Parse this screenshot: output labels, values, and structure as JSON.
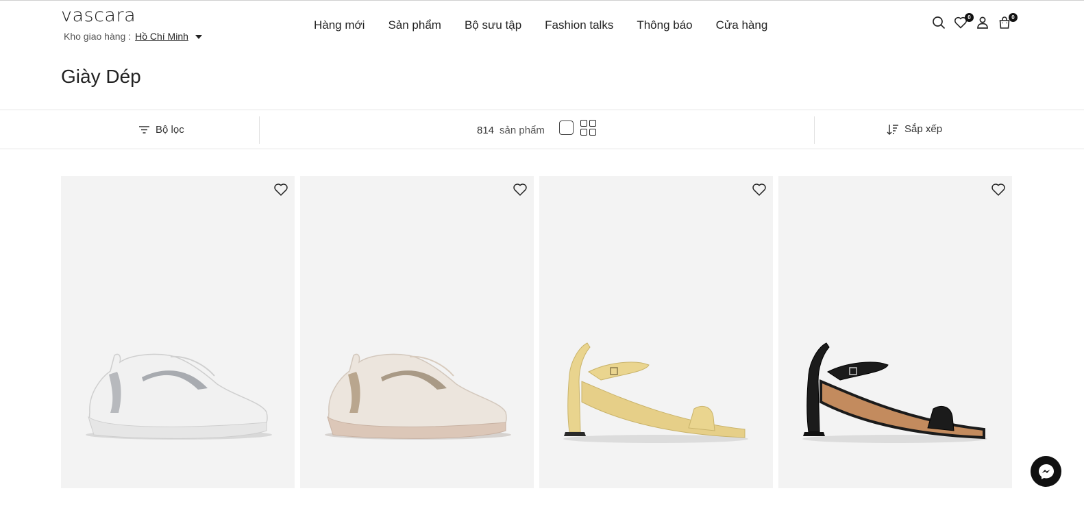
{
  "brand": {
    "logo": "vascara"
  },
  "warehouse": {
    "label": "Kho giao hàng :",
    "city": "Hồ Chí Minh"
  },
  "nav": [
    "Hàng mới",
    "Sản phẩm",
    "Bộ sưu tập",
    "Fashion talks",
    "Thông báo",
    "Cửa hàng"
  ],
  "header_icons": {
    "search": "search-icon",
    "wishlist": "heart-icon",
    "wishlist_count": "0",
    "account": "user-icon",
    "cart": "bag-icon",
    "cart_count": "0"
  },
  "page": {
    "title": "Giày Dép"
  },
  "toolbar": {
    "filter_label": "Bộ lọc",
    "count_value": "814",
    "count_label": "sản phẩm",
    "sort_label": "Sắp xếp"
  },
  "products": [
    {
      "image": "white-silver-sneaker",
      "color": "#ececec"
    },
    {
      "image": "beige-gold-sneaker",
      "color": "#e3d7cc"
    },
    {
      "image": "yellow-block-heel-sandal",
      "color": "#e9d48e"
    },
    {
      "image": "black-block-heel-sandal",
      "color": "#1b1b1b"
    }
  ],
  "colors": {
    "card_bg": "#f3f3f3",
    "text": "#222222",
    "border": "#e5e5e5"
  }
}
